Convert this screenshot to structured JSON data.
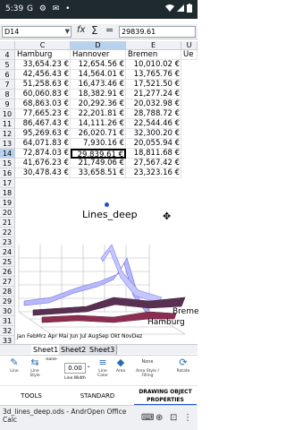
{
  "status_bar": {
    "time": "5:39",
    "notification_icons": "G ⚙ ✉ •"
  },
  "formula_bar": {
    "cell_ref": "D14",
    "fx_label": "fx",
    "sigma_label": "Σ",
    "equals_label": "=",
    "value": "29839.61"
  },
  "grid": {
    "columns": [
      "C",
      "D",
      "E",
      "U"
    ],
    "header_row": {
      "number": "4",
      "cells": [
        "Hamburg",
        "Hannover",
        "Bremen",
        "Ue"
      ]
    },
    "rows": [
      {
        "num": "5",
        "cells": [
          "33,654.23 €",
          "12,654.56 €",
          "10,010.02 €"
        ]
      },
      {
        "num": "6",
        "cells": [
          "42,456.43 €",
          "14,564.01 €",
          "13,765.76 €"
        ]
      },
      {
        "num": "7",
        "cells": [
          "51,258.63 €",
          "16,473.46 €",
          "17,521.50 €"
        ]
      },
      {
        "num": "8",
        "cells": [
          "60,060.83 €",
          "18,382.91 €",
          "21,277.24 €"
        ]
      },
      {
        "num": "9",
        "cells": [
          "68,863.03 €",
          "20,292.36 €",
          "20,032.98 €"
        ]
      },
      {
        "num": "10",
        "cells": [
          "77,665.23 €",
          "22,201.81 €",
          "28,788.72 €"
        ]
      },
      {
        "num": "11",
        "cells": [
          "86,467.43 €",
          "14,111.26 €",
          "22,544.46 €"
        ]
      },
      {
        "num": "12",
        "cells": [
          "95,269.63 €",
          "26,020.71 €",
          "32,300.20 €"
        ]
      },
      {
        "num": "13",
        "cells": [
          "64,071.83 €",
          "7,930.16 €",
          "20,055.94 €"
        ]
      },
      {
        "num": "14",
        "cells": [
          "72,874.03 €",
          "29,839.61 €",
          "18,811.68 €"
        ]
      },
      {
        "num": "15",
        "cells": [
          "41,676.23 €",
          "21,749.06 €",
          "27,567.42 €"
        ]
      },
      {
        "num": "16",
        "cells": [
          "30,478.43 €",
          "33,658.51 €",
          "23,323.16 €"
        ]
      }
    ],
    "empty_rows": [
      "17",
      "18",
      "19",
      "20",
      "21",
      "22",
      "23",
      "24",
      "25",
      "26",
      "27",
      "28",
      "29",
      "30",
      "31",
      "32",
      "33"
    ]
  },
  "chart": {
    "title": "Lines_deep",
    "months": [
      "Jan",
      "Feb",
      "Mar",
      "Apr",
      "May",
      "Jun",
      "Jul",
      "Aug",
      "Sep",
      "Oct",
      "Nov",
      "Dec"
    ],
    "month_strip": "Jan FebMrz Apr Mai Jun Jul AugSep Okt NovDez",
    "series_labels": [
      "Breme",
      "Hamburg"
    ]
  },
  "sheet_tabs": [
    "Sheet1",
    "Sheet2",
    "Sheet3"
  ],
  "toolbar": {
    "line_label": "Line",
    "arrow_label": "Line Style",
    "none_label": "-none-",
    "width_value": "0.00",
    "width_unit": "\"",
    "width_label": "Line Width",
    "color_label": "Line Color",
    "area_label": "Area",
    "area_style_value": "None",
    "area_style_label": "Area Style / Filling",
    "rotate_label": "Rotate"
  },
  "bottom_tabs": {
    "tools": "TOOLS",
    "standard": "STANDARD",
    "drawing": "DRAWING OBJECT PROPERTIES"
  },
  "taskbar": {
    "file_info": "3d_lines_deep.ods - AndrOpen Office Calc"
  },
  "colors": {
    "accent": "#1a4fd8",
    "selection": "#b6d2ef"
  }
}
